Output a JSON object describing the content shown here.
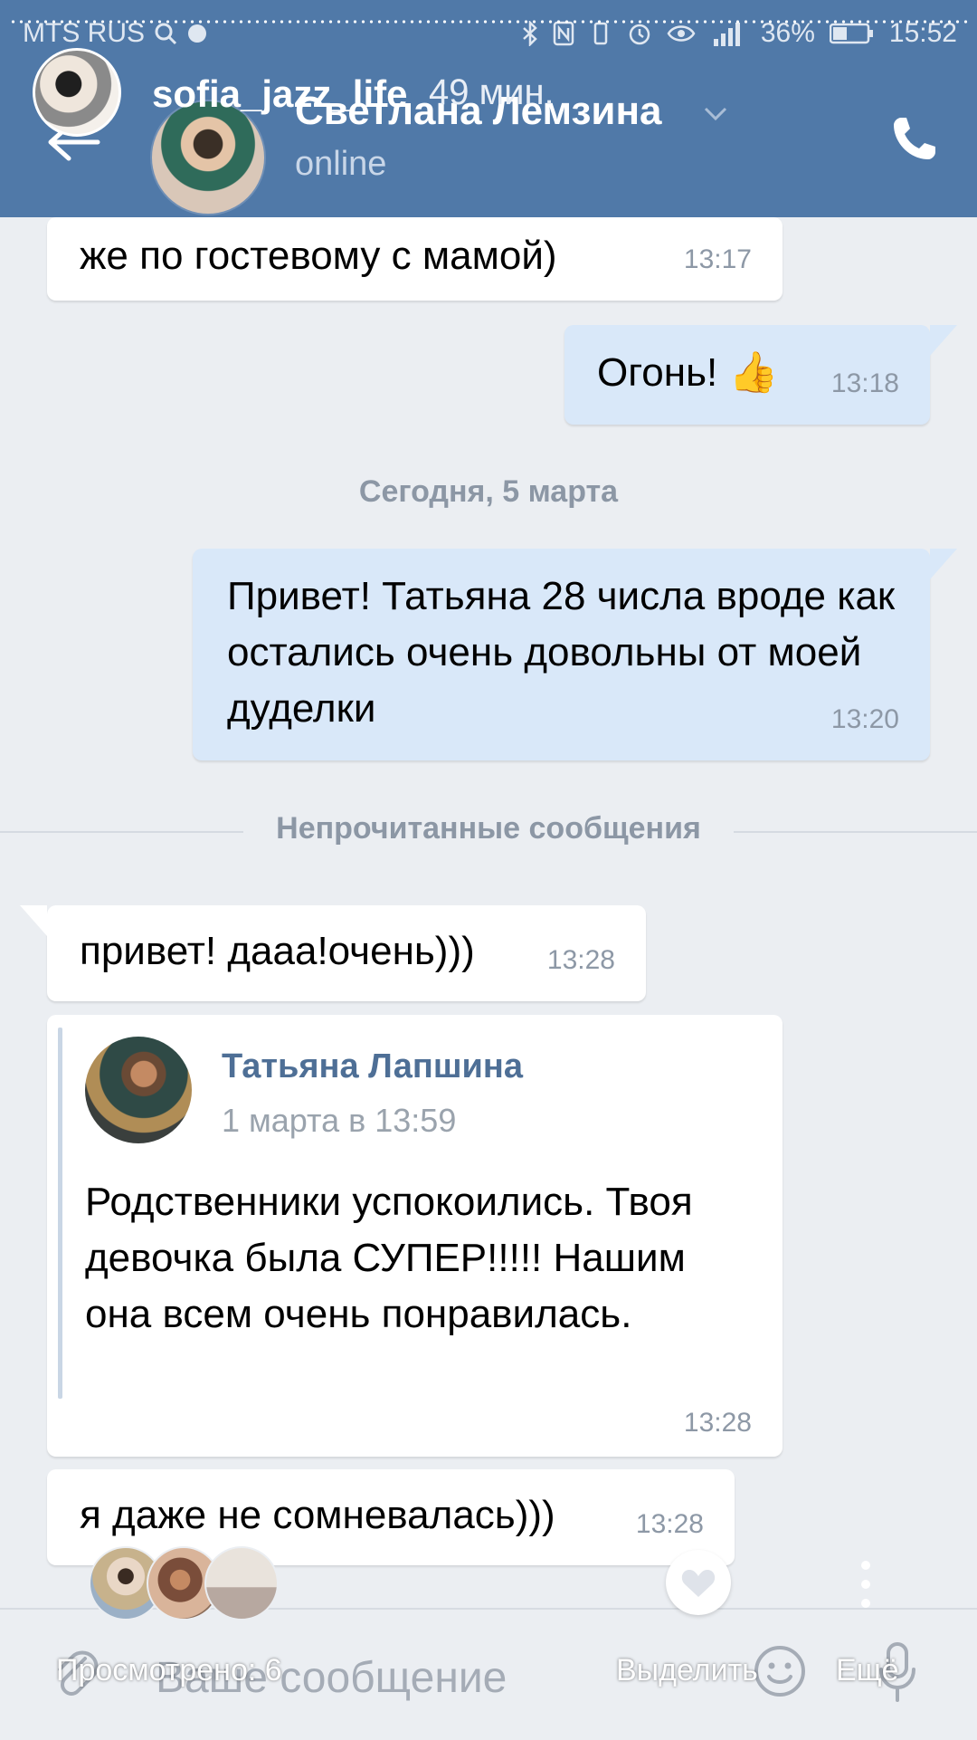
{
  "status_bar": {
    "carrier": "MTS RUS",
    "battery": "36%",
    "time": "15:52"
  },
  "story": {
    "username": "sofia_jazz_life",
    "time_ago": "49 мин."
  },
  "header": {
    "contact_name": "Светлана Лемзина",
    "contact_status": "online"
  },
  "messages": [
    {
      "text": "же по гостевому с мамой)",
      "time": "13:17"
    },
    {
      "text": "Огонь! 👍",
      "time": "13:18"
    },
    {
      "text": "Привет! Татьяна 28 числа вроде как остались очень довольны от моей дуделки",
      "time": "13:20"
    },
    {
      "text": "привет! дааа!очень)))",
      "time": "13:28"
    },
    {
      "text": "я даже не сомневалась)))",
      "time": "13:28"
    }
  ],
  "date_separator": "Сегодня, 5 марта",
  "unread_label": "Непрочитанные сообщения",
  "forwarded": {
    "author": "Татьяна Лапшина",
    "date": "1 марта в 13:59",
    "text": "Родственники успокоились. Твоя девочка была СУПЕР!!!!! Нашим она всем очень понравилась.",
    "time": "13:28"
  },
  "input": {
    "placeholder": "Ваше сообщение"
  },
  "story_footer": {
    "viewed": "Просмотрено: 6",
    "select": "Выделить",
    "more": "Ещё"
  },
  "colors": {
    "header": "#5079a8",
    "outgoing_bubble": "#d9e8f9",
    "incoming_bubble": "#ffffff",
    "chat_bg": "#ebeef2",
    "author_link": "#4e6f96"
  }
}
